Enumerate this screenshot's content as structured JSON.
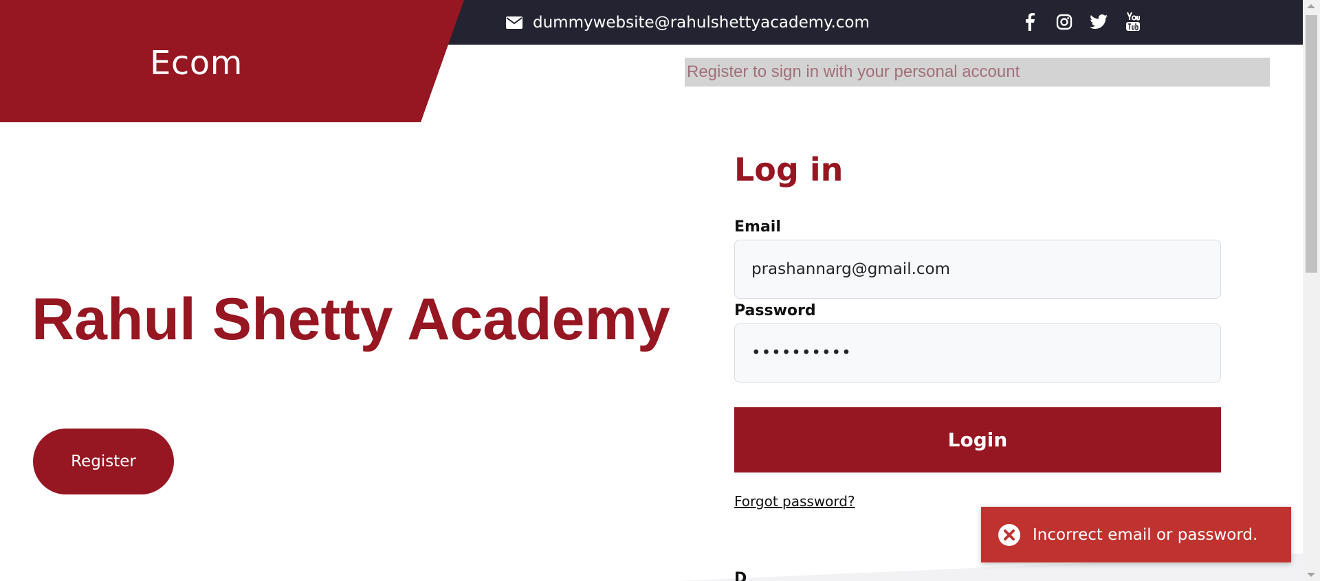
{
  "header": {
    "brand": "Ecom",
    "contact_email": "dummywebsite@rahulshettyacademy.com",
    "social_icons": [
      "facebook-icon",
      "instagram-icon",
      "twitter-icon",
      "youtube-icon"
    ],
    "register_hint": "Register to sign in with your personal account"
  },
  "hero": {
    "title": "Rahul Shetty Academy",
    "register_label": "Register"
  },
  "login": {
    "title": "Log in",
    "email_label": "Email",
    "email_value": "prashannarg@gmail.com",
    "password_label": "Password",
    "password_value": "••••••••••",
    "submit_label": "Login",
    "forgot_label": "Forgot password?",
    "partial_next_label": "D"
  },
  "toast": {
    "message": "Incorrect email or password.",
    "icon": "error-circle-icon"
  },
  "colors": {
    "brand": "#961621",
    "topbar": "#232331",
    "toast": "#c0322f"
  }
}
